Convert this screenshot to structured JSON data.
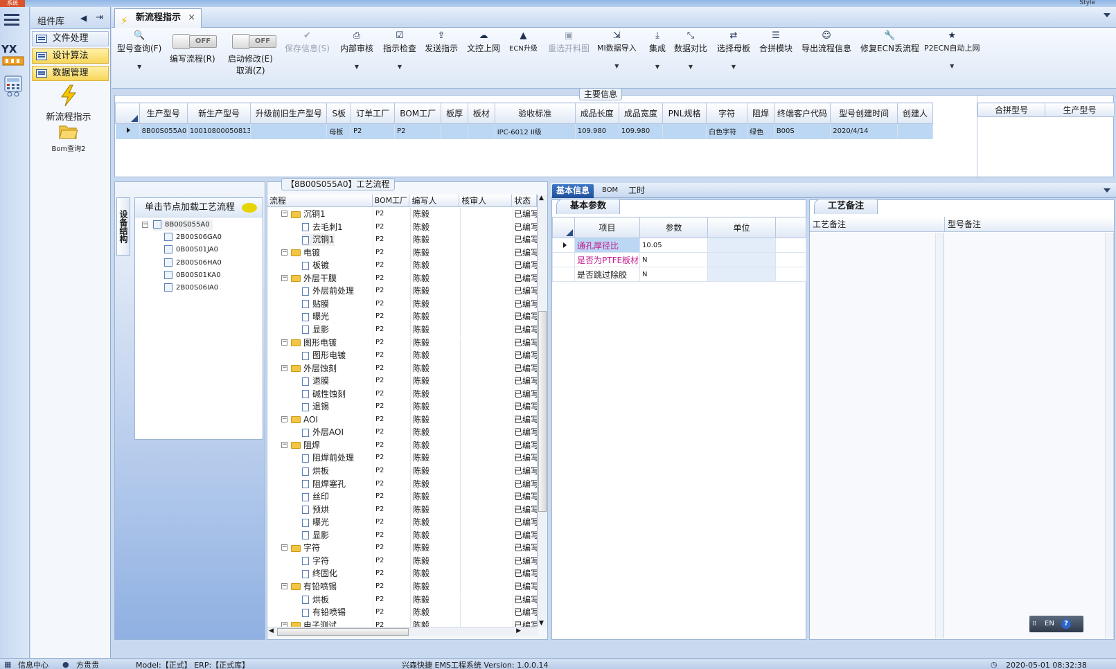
{
  "top": {
    "system": "系统",
    "style": "Style"
  },
  "library": {
    "title": "组件库",
    "items": [
      {
        "label": "文件处理"
      },
      {
        "label": "设计算法"
      },
      {
        "label": "数据管理"
      }
    ],
    "icons": [
      {
        "label": "新流程指示"
      },
      {
        "label": "Bom查询2"
      }
    ]
  },
  "doc_tab": {
    "label": "新流程指示",
    "close": "×"
  },
  "toolbar": {
    "query": "型号查询(F)",
    "write_flow": "编写流程(R)",
    "auto_modify": "启动修改(E)",
    "cancel": "取消(Z)",
    "save": "保存信息(S)",
    "internal_review": "内部审核",
    "instruction_check": "指示检查",
    "send_instruction": "发送指示",
    "doc_upload": "文控上网",
    "ecn_upgrade": "ECN升级",
    "reselect_cut": "重选开料图",
    "mi_import": "MI数据导入",
    "integrate": "集成",
    "data_compare": "数据对比",
    "select_mother": "选择母板",
    "merge_module": "合拼模块",
    "export_flow": "导出流程信息",
    "repair_ecn": "修复ECN丢流程",
    "p2ecn_auto": "P2ECN自动上网",
    "toggle_off": "OFF"
  },
  "main_info": {
    "legend": "主要信息",
    "columns": [
      "生产型号",
      "新生产型号",
      "升级前旧生产型号",
      "S板",
      "订单工厂",
      "BOM工厂",
      "板厚",
      "板材",
      "验收标准",
      "成品长度",
      "成品宽度",
      "PNL规格",
      "字符",
      "阻焊",
      "终端客户代码",
      "型号创建时间",
      "创建人"
    ],
    "row": [
      "8B00S055A0",
      "10010800050813",
      "",
      "母板",
      "P2",
      "P2",
      "",
      "",
      "IPC-6012 II级",
      "109.980",
      "109.980",
      "",
      "白色字符",
      "绿色",
      "B00S",
      "2020/4/14",
      ""
    ],
    "merge_columns": [
      "合拼型号",
      "生产型号"
    ]
  },
  "structure": {
    "vtab": "设备结构",
    "header": "单击节点加载工艺流程",
    "root": "8B00S055A0",
    "children": [
      "2B00S06GA0",
      "0B00S01JA0",
      "2B00S06HA0",
      "0B00S01KA0",
      "2B00S06IA0"
    ]
  },
  "process": {
    "legend": "【8B00S055A0】工艺流程",
    "columns": [
      "流程",
      "BOM工厂",
      "编写人",
      "核审人",
      "状态"
    ],
    "factory": "P2",
    "writer": "陈毅",
    "status": "已编写",
    "rows": [
      {
        "name": "沉铜1",
        "folder": true
      },
      {
        "name": "去毛刺1",
        "folder": false
      },
      {
        "name": "沉铜1",
        "folder": false
      },
      {
        "name": "电镀",
        "folder": true
      },
      {
        "name": "板镀",
        "folder": false
      },
      {
        "name": "外层干膜",
        "folder": true
      },
      {
        "name": "外层前处理",
        "folder": false
      },
      {
        "name": "贴膜",
        "folder": false
      },
      {
        "name": "曝光",
        "folder": false
      },
      {
        "name": "显影",
        "folder": false
      },
      {
        "name": "图形电镀",
        "folder": true
      },
      {
        "name": "图形电镀",
        "folder": false
      },
      {
        "name": "外层蚀刻",
        "folder": true
      },
      {
        "name": "退膜",
        "folder": false
      },
      {
        "name": "碱性蚀刻",
        "folder": false
      },
      {
        "name": "退锡",
        "folder": false
      },
      {
        "name": "AOI",
        "folder": true
      },
      {
        "name": "外层AOI",
        "folder": false
      },
      {
        "name": "阻焊",
        "folder": true
      },
      {
        "name": "阻焊前处理",
        "folder": false
      },
      {
        "name": "烘板",
        "folder": false
      },
      {
        "name": "阻焊塞孔",
        "folder": false
      },
      {
        "name": "丝印",
        "folder": false
      },
      {
        "name": "预烘",
        "folder": false
      },
      {
        "name": "曝光",
        "folder": false
      },
      {
        "name": "显影",
        "folder": false
      },
      {
        "name": "字符",
        "folder": true
      },
      {
        "name": "字符",
        "folder": false
      },
      {
        "name": "终固化",
        "folder": false
      },
      {
        "name": "有铅喷锡",
        "folder": true
      },
      {
        "name": "烘板",
        "folder": false
      },
      {
        "name": "有铅喷锡",
        "folder": false
      },
      {
        "name": "电子测试",
        "folder": true
      }
    ]
  },
  "right_tabs": [
    "基本信息",
    "BOM",
    "工时"
  ],
  "basic_params": {
    "tab": "基本参数",
    "columns": [
      "项目",
      "参数",
      "单位"
    ],
    "rows": [
      {
        "item": "通孔厚径比",
        "value": "10.05",
        "unit": ""
      },
      {
        "item": "是否为PTFE板材",
        "value": "N",
        "unit": ""
      },
      {
        "item": "是否跳过除胶",
        "value": "N",
        "unit": ""
      }
    ]
  },
  "notes": {
    "tab": "工艺备注",
    "col1": "工艺备注",
    "col2": "型号备注"
  },
  "lang": {
    "code": "EN",
    "help": "?"
  },
  "status_bar": {
    "info_center": "信息中心",
    "user": "方贵贵",
    "db": "Model:【正式】 ERP:【正式库】",
    "app": "兴森快捷 EMS工程系统 Version: 1.0.0.14",
    "time": "2020-05-01 08:32:38"
  }
}
